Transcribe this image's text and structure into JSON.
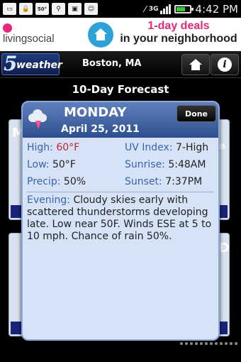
{
  "status_bar": {
    "temp_badge": "50°",
    "network": "3G",
    "time": "4:42 PM"
  },
  "ad": {
    "brand": "livingsocial",
    "line1": "1-day deals",
    "line2": "in your neighborhood"
  },
  "header": {
    "logo_number": "5",
    "logo_text": "weather",
    "location": "Boston, MA"
  },
  "page_title": "10-Day Forecast",
  "cards": {
    "left1_letter": "M",
    "right1_letter": "e",
    "left2_letter": "",
    "right2_letter": "D"
  },
  "popup": {
    "day": "MONDAY",
    "date": "April 25, 2011",
    "done_label": "Done",
    "high_label": "High:",
    "high_value": "60°F",
    "low_label": "Low:",
    "low_value": "50°F",
    "precip_label": "Precip:",
    "precip_value": "50%",
    "uv_label": "UV Index:",
    "uv_value": "7-High",
    "sunrise_label": "Sunrise:",
    "sunrise_value": "5:48AM",
    "sunset_label": "Sunset:",
    "sunset_value": "7:37PM",
    "evening_label": "Evening:",
    "evening_text": "Cloudy skies early with scattered thunderstorms developing late. Low near 50F. Winds ESE at 5 to 10 mph. Chance of rain 50%."
  },
  "colors": {
    "high_temp": "#c4232f",
    "label_blue": "#3a63b0",
    "ad_pink": "#e5287c"
  }
}
